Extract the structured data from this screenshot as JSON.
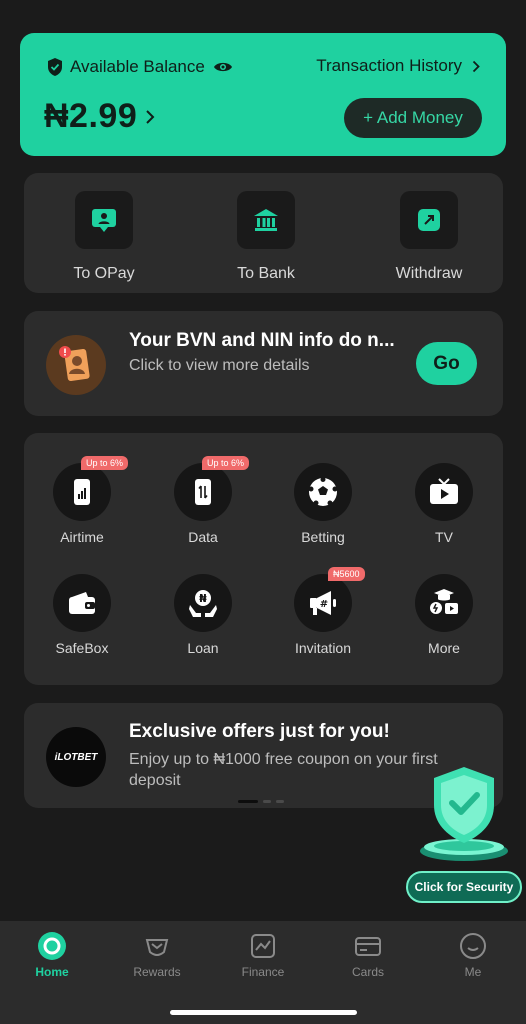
{
  "balance": {
    "label": "Available Balance",
    "amount": "₦2.99",
    "transaction_history": "Transaction History",
    "add_money": "+ Add Money"
  },
  "transfer": {
    "items": [
      {
        "label": "To OPay",
        "icon": "person-card-icon"
      },
      {
        "label": "To Bank",
        "icon": "bank-icon"
      },
      {
        "label": "Withdraw",
        "icon": "withdraw-arrow-icon"
      }
    ]
  },
  "notice": {
    "title": "Your BVN and NIN info do n...",
    "subtitle": "Click to view more details",
    "go": "Go"
  },
  "services": {
    "items": [
      {
        "label": "Airtime",
        "badge": "Up to 6%",
        "icon": "phone-signal-icon"
      },
      {
        "label": "Data",
        "badge": "Up to 6%",
        "icon": "phone-data-icon"
      },
      {
        "label": "Betting",
        "badge": "",
        "icon": "soccer-ball-icon"
      },
      {
        "label": "TV",
        "badge": "",
        "icon": "tv-icon"
      },
      {
        "label": "SafeBox",
        "badge": "",
        "icon": "wallet-icon"
      },
      {
        "label": "Loan",
        "badge": "",
        "icon": "hands-coin-icon"
      },
      {
        "label": "Invitation",
        "badge": "₦5600",
        "icon": "megaphone-icon"
      },
      {
        "label": "More",
        "badge": "",
        "icon": "more-grid-icon"
      }
    ]
  },
  "offer": {
    "logo_text": "iLOTBET",
    "title": "Exclusive offers just for you!",
    "subtitle": "Enjoy up to ₦1000 free coupon on your first deposit"
  },
  "security": {
    "label": "Click for Security"
  },
  "nav": {
    "items": [
      {
        "label": "Home",
        "icon": "home-icon"
      },
      {
        "label": "Rewards",
        "icon": "rewards-icon"
      },
      {
        "label": "Finance",
        "icon": "finance-chart-icon"
      },
      {
        "label": "Cards",
        "icon": "card-icon"
      },
      {
        "label": "Me",
        "icon": "profile-icon"
      }
    ]
  },
  "colors": {
    "accent": "#1fd1a0",
    "background": "#1b1b1b",
    "panel": "#2c2c2c",
    "badge": "#f06a6a"
  }
}
